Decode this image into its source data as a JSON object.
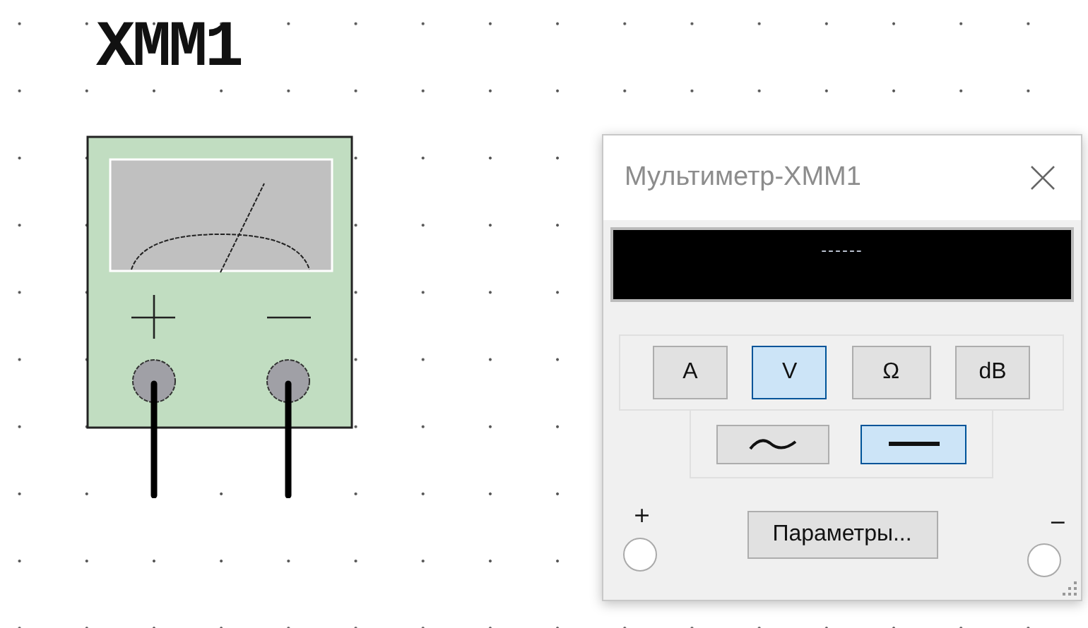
{
  "canvas": {
    "component_label": "XMM1"
  },
  "window": {
    "title": "Мультиметр-XMM1",
    "display": "------",
    "modes": [
      {
        "label": "A",
        "selected": false
      },
      {
        "label": "V",
        "selected": true
      },
      {
        "label": "Ω",
        "selected": false
      },
      {
        "label": "dB",
        "selected": false
      }
    ],
    "signal_types": [
      {
        "kind": "ac",
        "selected": false
      },
      {
        "kind": "dc",
        "selected": true
      }
    ],
    "settings_button": "Параметры...",
    "terminals": [
      {
        "label": "+"
      },
      {
        "label": "−"
      }
    ]
  }
}
